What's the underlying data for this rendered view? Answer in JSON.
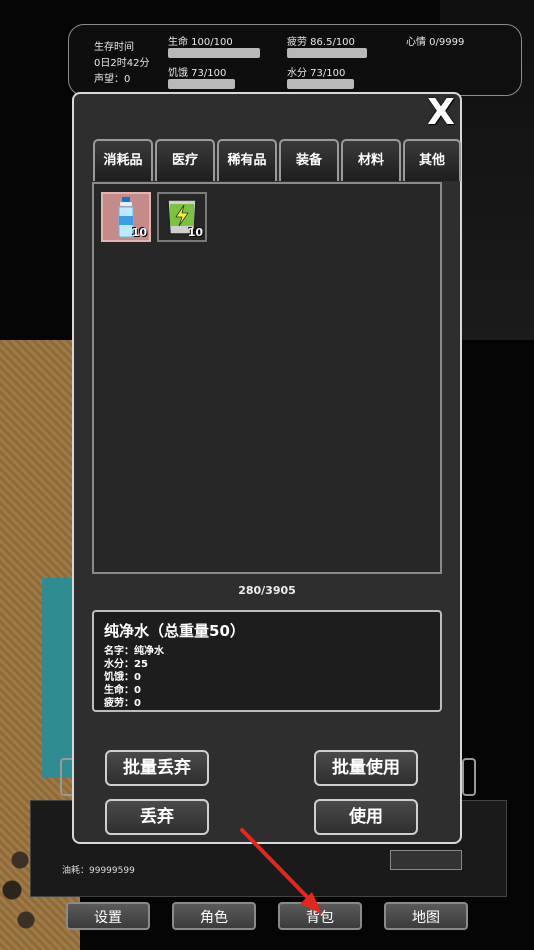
{
  "status": {
    "survival_label": "生存时间",
    "survival_time": "0日2时42分",
    "reputation": "声望：0",
    "health": "生命 100/100",
    "health_pct": 1.0,
    "fatigue": "疲劳 86.5/100",
    "fatigue_pct": 0.865,
    "mood": "心情 0/9999",
    "hunger": "饥饿 73/100",
    "hunger_pct": 0.73,
    "water": "水分 73/100",
    "water_pct": 0.73
  },
  "modal": {
    "close_label": "X",
    "tabs": [
      "消耗品",
      "医疗",
      "稀有品",
      "装备",
      "材料",
      "其他"
    ],
    "items": [
      {
        "icon": "water-bottle-icon",
        "qty": "10",
        "selected": true
      },
      {
        "icon": "cookie-bag-icon",
        "qty": "10",
        "selected": false
      }
    ],
    "capacity": "280/3905",
    "detail": {
      "title": "纯净水（总重量50）",
      "lines": [
        "名字：纯净水",
        "水分：25",
        "饥饿：0",
        "生命：0",
        "疲劳：0"
      ]
    },
    "buttons": {
      "batch_discard": "批量丢弃",
      "batch_use": "批量使用",
      "discard": "丢弃",
      "use": "使用"
    }
  },
  "bottom": {
    "fuel": "油耗：99999599",
    "nav": [
      "设置",
      "角色",
      "背包",
      "地图"
    ]
  },
  "colors": {
    "selected_slot": "#c58b88",
    "arrow": "#e0291c"
  }
}
